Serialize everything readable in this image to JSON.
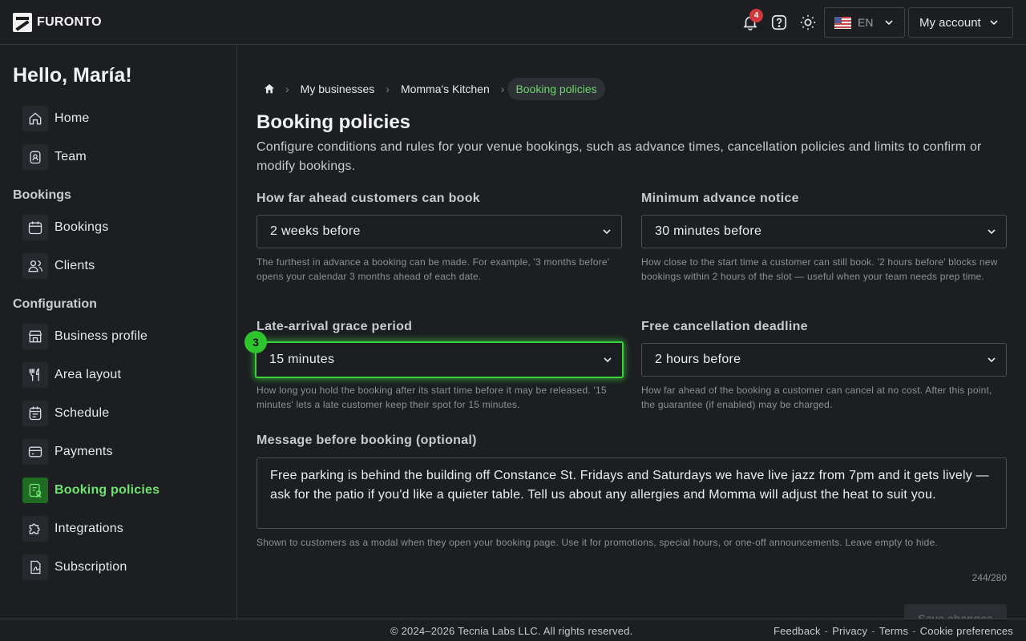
{
  "brand": {
    "name": "FURONTO"
  },
  "topbar": {
    "notifications_count": "4",
    "language": "EN",
    "account_label": "My account"
  },
  "sidebar": {
    "greeting": "Hello, María!",
    "top_items": [
      {
        "label": "Home",
        "icon": "home-icon"
      },
      {
        "label": "Team",
        "icon": "badge-icon"
      }
    ],
    "section_bookings": "Bookings",
    "booking_items": [
      {
        "label": "Bookings",
        "icon": "calendar-icon"
      },
      {
        "label": "Clients",
        "icon": "users-icon"
      }
    ],
    "section_configuration": "Configuration",
    "config_items": [
      {
        "label": "Business profile",
        "icon": "store-icon"
      },
      {
        "label": "Area layout",
        "icon": "utensils-icon"
      },
      {
        "label": "Schedule",
        "icon": "schedule-icon"
      },
      {
        "label": "Payments",
        "icon": "card-icon"
      },
      {
        "label": "Booking policies",
        "icon": "policy-icon",
        "active": true
      },
      {
        "label": "Integrations",
        "icon": "puzzle-icon"
      },
      {
        "label": "Subscription",
        "icon": "subscription-icon"
      }
    ]
  },
  "breadcrumb": {
    "items": [
      "My businesses",
      "Momma's Kitchen"
    ],
    "current": "Booking policies"
  },
  "page": {
    "title": "Booking policies",
    "description": "Configure conditions and rules for your venue bookings, such as advance times, cancellation policies and limits to confirm or modify bookings."
  },
  "fields": {
    "advance": {
      "label": "How far ahead customers can book",
      "value": "2 weeks before",
      "help": "The furthest in advance a booking can be made. For example, '3 months before' opens your calendar 3 months ahead of each date."
    },
    "min_notice": {
      "label": "Minimum advance notice",
      "value": "30 minutes before",
      "help": "How close to the start time a customer can still book. '2 hours before' blocks new bookings within 2 hours of the slot — useful when your team needs prep time."
    },
    "grace": {
      "label": "Late-arrival grace period",
      "value": "15 minutes",
      "help": "How long you hold the booking after its start time before it may be released. '15 minutes' lets a late customer keep their spot for 15 minutes.",
      "step": "3"
    },
    "cancel": {
      "label": "Free cancellation deadline",
      "value": "2 hours before",
      "help": "How far ahead of the booking a customer can cancel at no cost. After this point, the guarantee (if enabled) may be charged."
    },
    "message": {
      "label": "Message before booking (optional)",
      "value": "Free parking is behind the building off Constance St. Fridays and Saturdays we have live jazz from 7pm and it gets lively — ask for the patio if you'd like a quieter table. Tell us about any allergies and Momma will adjust the heat to suit you.",
      "help": "Shown to customers as a modal when they open your booking page. Use it for promotions, special hours, or one-off announcements. Leave empty to hide.",
      "counter": "244/280"
    }
  },
  "save_label": "Save changes",
  "footer": {
    "copyright": "© 2024–2026 Tecnia Labs LLC. All rights reserved.",
    "links": [
      "Feedback",
      "Privacy",
      "Terms",
      "Cookie preferences"
    ]
  },
  "colors": {
    "background": "#1c1e21",
    "accent": "#6ee36e",
    "focus": "#3ad33a",
    "badge": "#d2373a"
  }
}
